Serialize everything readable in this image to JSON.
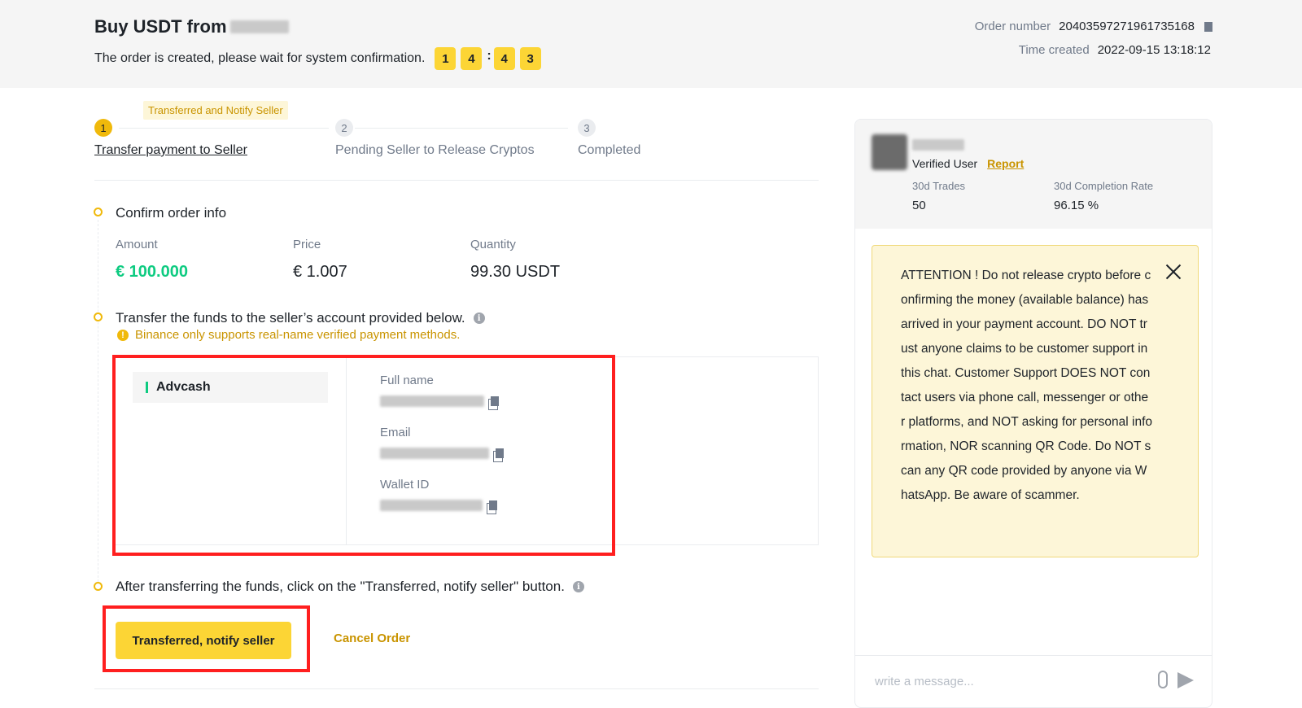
{
  "header": {
    "title": "Buy USDT from",
    "subtitle": "The order is created, please wait for system confirmation.",
    "timer_digits": [
      "1",
      "4",
      "4",
      "3"
    ],
    "timer_separator": ":",
    "order_number_label": "Order number",
    "order_number": "20403597271961735168",
    "time_created_label": "Time created",
    "time_created": "2022-09-15 13:18:12"
  },
  "steps": {
    "badge": "Transferred and Notify Seller",
    "items": [
      {
        "num": "1",
        "label": "Transfer payment to Seller"
      },
      {
        "num": "2",
        "label": "Pending Seller to Release Cryptos"
      },
      {
        "num": "3",
        "label": "Completed"
      }
    ]
  },
  "confirm": {
    "title": "Confirm order info",
    "amount_label": "Amount",
    "amount": "€ 100.000",
    "price_label": "Price",
    "price": "€ 1.007",
    "quantity_label": "Quantity",
    "quantity": "99.30 USDT"
  },
  "transfer": {
    "title": "Transfer the funds to the seller’s account provided below.",
    "warning": "Binance only supports real-name verified payment methods.",
    "method": "Advcash",
    "fields": [
      {
        "label": "Full name"
      },
      {
        "label": "Email"
      },
      {
        "label": "Wallet ID"
      }
    ]
  },
  "after": {
    "title": "After transferring the funds, click on the \"Transferred, notify seller\" button.",
    "primary_button": "Transferred, notify seller",
    "cancel_button": "Cancel Order"
  },
  "seller": {
    "verified": "Verified User",
    "report": "Report",
    "trades_label": "30d Trades",
    "trades": "50",
    "completion_label": "30d Completion Rate",
    "completion": "96.15 %"
  },
  "notice": {
    "text": "ATTENTION ! Do not release crypto before confirming the money (available balance) has arrived in your payment account. DO NOT trust anyone claims to be customer support in this chat. Customer Support DOES NOT contact users via phone call, messenger or other platforms, and NOT asking for personal information, NOR scanning QR Code. Do NOT scan any QR code provided by anyone via WhatsApp. Be aware of scammer."
  },
  "chat": {
    "placeholder": "write a message..."
  },
  "colors": {
    "accent": "#fcd535",
    "accent_text": "#c99400",
    "green": "#0ecb81",
    "highlight": "#ff1f1f"
  }
}
